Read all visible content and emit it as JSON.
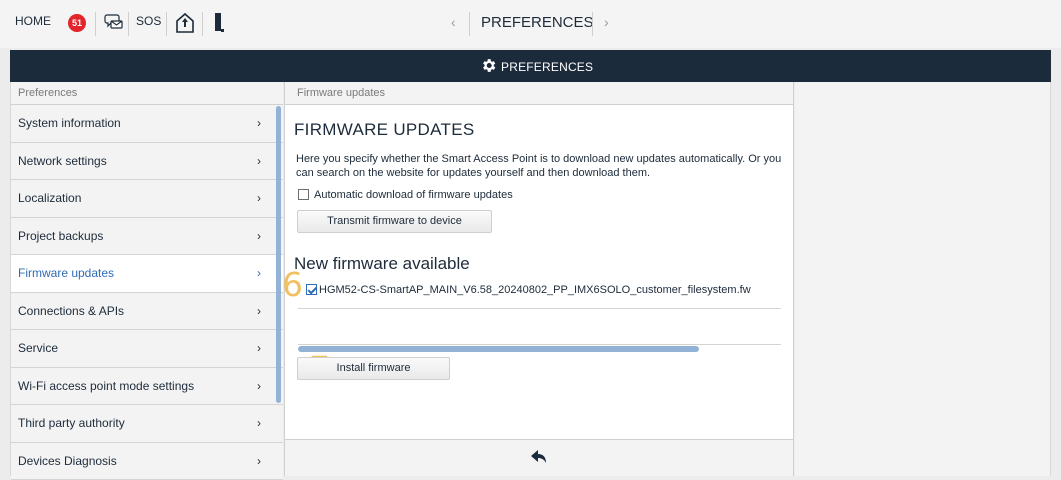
{
  "topbar": {
    "home_label": "HOME",
    "notification_count": "51",
    "sos_label": "SOS",
    "prev_arrow": "‹",
    "next_arrow": "›",
    "page_title": "PREFERENCES"
  },
  "header": {
    "title": "PREFERENCES",
    "icon": "gear-icon"
  },
  "sidebar": {
    "header": "Preferences",
    "chevron": "›",
    "items": [
      {
        "label": "System information",
        "active": false
      },
      {
        "label": "Network settings",
        "active": false
      },
      {
        "label": "Localization",
        "active": false
      },
      {
        "label": "Project backups",
        "active": false
      },
      {
        "label": "Firmware updates",
        "active": true
      },
      {
        "label": "Connections & APIs",
        "active": false
      },
      {
        "label": "Service",
        "active": false
      },
      {
        "label": "Wi-Fi access point mode settings",
        "active": false
      },
      {
        "label": "Third party authority",
        "active": false
      },
      {
        "label": "Devices Diagnosis",
        "active": false
      }
    ]
  },
  "main": {
    "header": "Firmware updates",
    "title": "FIRMWARE UPDATES",
    "description": "Here you specify whether the Smart Access Point is to download new updates automatically. Or you can search on the website for updates yourself and then download them.",
    "auto_download_label": "Automatic download of firmware updates",
    "auto_download_checked": false,
    "transmit_button": "Transmit firmware to device",
    "new_firmware_title": "New firmware available",
    "firmware_file": "HGM52-CS-SmartAP_MAIN_V6.58_20240802_PP_IMX6SOLO_customer_filesystem.fw",
    "firmware_checked": true,
    "progress_fraction": 0.83,
    "install_button": "Install firmware",
    "marker_6": "6",
    "marker_7": "7"
  },
  "colors": {
    "header_bg": "#1c2b3c",
    "accent": "#2f6cb5",
    "badge": "#e3242b",
    "marker": "#f2c060",
    "progress": "#93b3d6"
  }
}
